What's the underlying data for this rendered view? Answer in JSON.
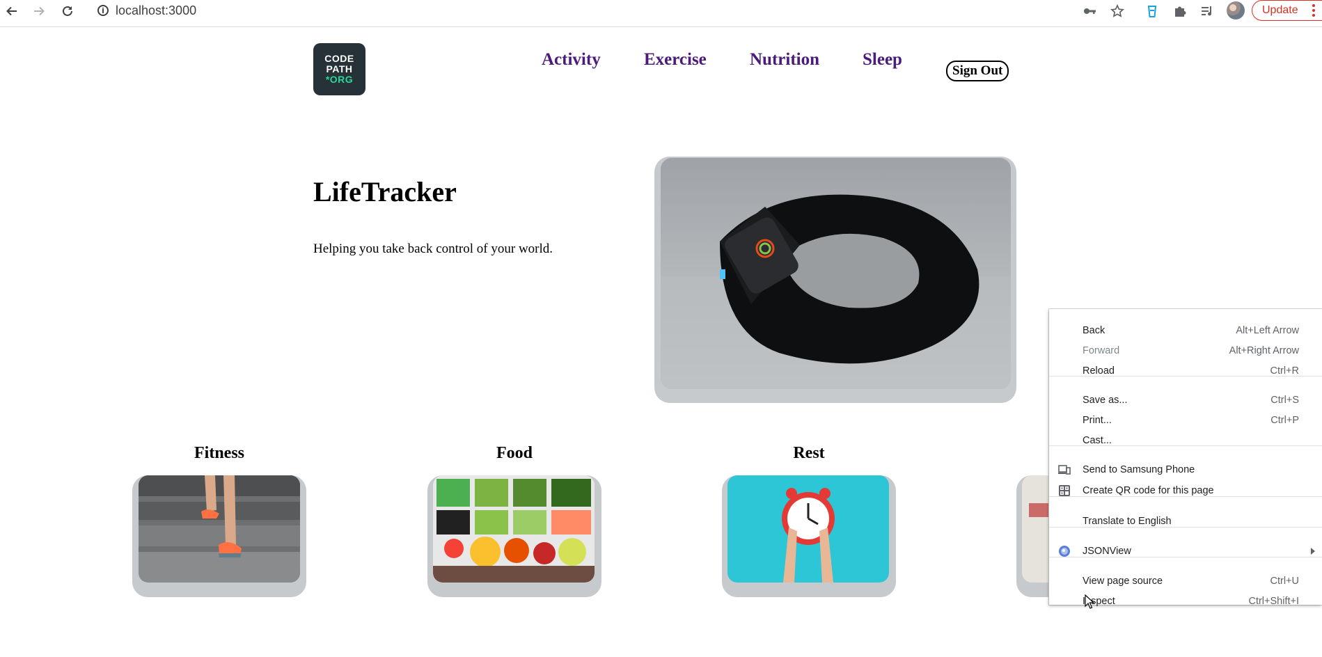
{
  "browser": {
    "url": "localhost:3000",
    "update_label": "Update"
  },
  "site": {
    "logo": {
      "line1": "CODE",
      "line2": "PATH",
      "line3": "*ORG"
    },
    "nav": [
      "Activity",
      "Exercise",
      "Nutrition",
      "Sleep"
    ],
    "sign_out": "Sign Out"
  },
  "hero": {
    "title": "LifeTracker",
    "tagline": "Helping you take back control of your world."
  },
  "cards": [
    "Fitness",
    "Food",
    "Rest"
  ],
  "context_menu": {
    "items": [
      {
        "label": "Back",
        "shortcut": "Alt+Left Arrow"
      },
      {
        "label": "Forward",
        "shortcut": "Alt+Right Arrow"
      },
      {
        "label": "Reload",
        "shortcut": "Ctrl+R"
      },
      {
        "label": "Save as...",
        "shortcut": "Ctrl+S"
      },
      {
        "label": "Print...",
        "shortcut": "Ctrl+P"
      },
      {
        "label": "Cast...",
        "shortcut": ""
      },
      {
        "label": "Send to Samsung Phone",
        "shortcut": ""
      },
      {
        "label": "Create QR code for this page",
        "shortcut": ""
      },
      {
        "label": "Translate to English",
        "shortcut": ""
      },
      {
        "label": "JSONView",
        "shortcut": ""
      },
      {
        "label": "View page source",
        "shortcut": "Ctrl+U"
      },
      {
        "label": "Inspect",
        "shortcut": "Ctrl+Shift+I"
      }
    ]
  },
  "colors": {
    "nav_link": "#4b1a7d",
    "logo_bg": "#263238",
    "logo_accent": "#2bd69b",
    "update_red": "#d93025",
    "card_frame": "#c7cacd"
  }
}
